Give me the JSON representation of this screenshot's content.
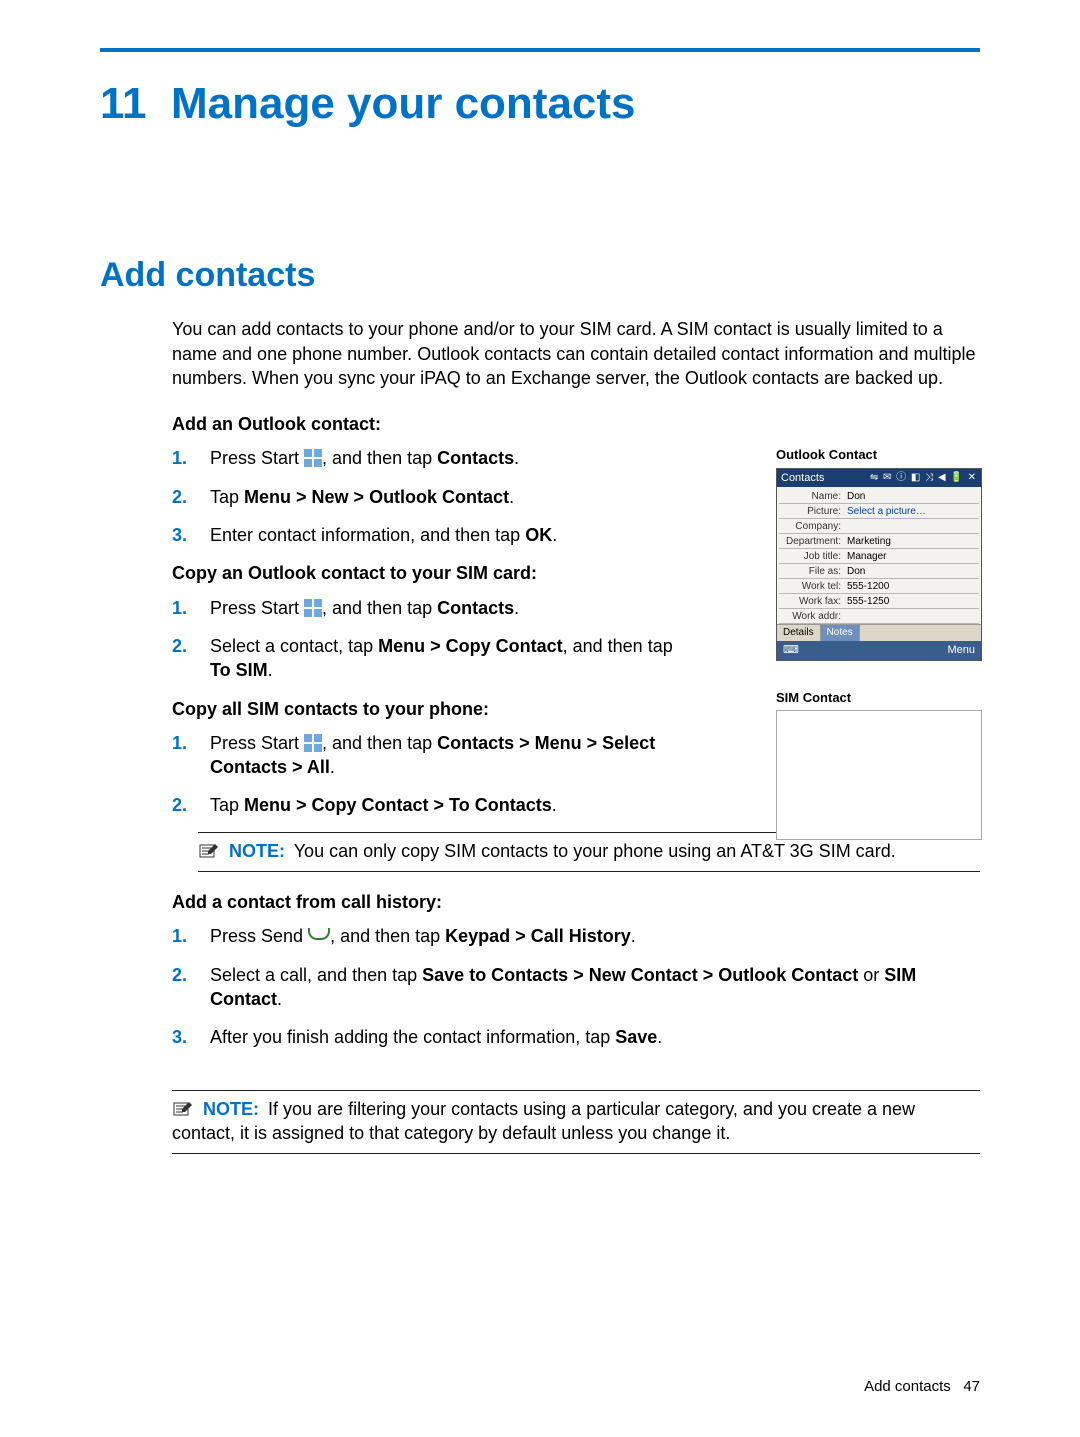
{
  "chapter": {
    "number": "11",
    "title": "Manage your contacts"
  },
  "section": {
    "title": "Add contacts"
  },
  "intro": "You can add contacts to your phone and/or to your SIM card. A SIM contact is usually limited to a name and one phone number. Outlook contacts can contain detailed contact information and multiple numbers. When you sync your iPAQ to an Exchange server, the Outlook contacts are backed up.",
  "sub1_title": "Add an Outlook contact:",
  "sub1_step1_a": "Press Start ",
  "sub1_step1_b": ", and then tap ",
  "sub1_step1_bold": "Contacts",
  "sub1_step1_c": ".",
  "sub1_step2_a": "Tap ",
  "sub1_step2_bold": "Menu > New > Outlook Contact",
  "sub1_step2_b": ".",
  "sub1_step3_a": "Enter contact information, and then tap ",
  "sub1_step3_bold": "OK",
  "sub1_step3_b": ".",
  "sub2_title": "Copy an Outlook contact to your SIM card:",
  "sub2_step1_a": "Press Start ",
  "sub2_step1_b": ", and then tap ",
  "sub2_step1_bold": "Contacts",
  "sub2_step1_c": ".",
  "sub2_step2_a": "Select a contact, tap ",
  "sub2_step2_bold1": "Menu > Copy Contact",
  "sub2_step2_b": ", and then tap ",
  "sub2_step2_bold2": "To SIM",
  "sub2_step2_c": ".",
  "sub3_title": "Copy all SIM contacts to your phone:",
  "sub3_step1_a": "Press Start ",
  "sub3_step1_b": ", and then tap ",
  "sub3_step1_bold": "Contacts > Menu > Select Contacts > All",
  "sub3_step1_c": ".",
  "sub3_step2_a": "Tap ",
  "sub3_step2_bold": "Menu > Copy Contact > To Contacts",
  "sub3_step2_b": ".",
  "note1_label": "NOTE:",
  "note1_text": "You can only copy SIM contacts to your phone using an AT&T 3G SIM card.",
  "sub4_title": "Add a contact from call history:",
  "sub4_step1_a": "Press Send ",
  "sub4_step1_b": ", and then tap ",
  "sub4_step1_bold": "Keypad > Call History",
  "sub4_step1_c": ".",
  "sub4_step2_a": "Select a call, and then tap ",
  "sub4_step2_bold1": "Save to Contacts > New Contact > Outlook Contact",
  "sub4_step2_b": " or ",
  "sub4_step2_bold2": "SIM Contact",
  "sub4_step2_c": ".",
  "sub4_step3_a": "After you finish adding the contact information, tap ",
  "sub4_step3_bold": "Save",
  "sub4_step3_b": ".",
  "note2_label": "NOTE:",
  "note2_text": "If you are filtering your contacts using a particular category, and you create a new contact, it is assigned to that category by default unless you change it.",
  "footer_text": "Add contacts",
  "footer_page": "47",
  "right": {
    "caption1": "Outlook Contact",
    "caption2": "SIM Contact",
    "header_title": "Contacts",
    "header_glyphs": "⇋ ✉ ⓘ ◧ ⤨ ◀ 🔋 ✕",
    "rows": [
      {
        "lab": "Name:",
        "val": "Don"
      },
      {
        "lab": "Picture:",
        "val": "Select a picture…",
        "blue": true
      },
      {
        "lab": "Company:",
        "val": ""
      },
      {
        "lab": "Department:",
        "val": "Marketing"
      },
      {
        "lab": "Job title:",
        "val": "Manager"
      },
      {
        "lab": "File as:",
        "val": "Don"
      },
      {
        "lab": "Work tel:",
        "val": "555-1200"
      },
      {
        "lab": "Work fax:",
        "val": "555-1250"
      },
      {
        "lab": "Work addr:",
        "val": ""
      }
    ],
    "tab_details": "Details",
    "tab_notes": "Notes",
    "footer_kbd": "⌨",
    "footer_menu": "Menu"
  }
}
